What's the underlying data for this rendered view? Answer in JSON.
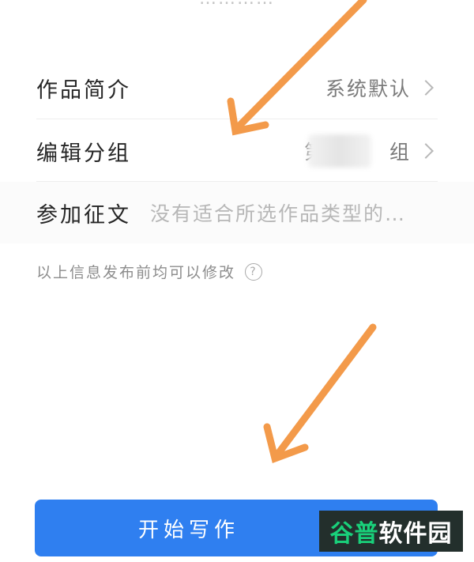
{
  "top_faded_text": "…………",
  "rows": {
    "intro": {
      "label": "作品简介",
      "value": "系统默认"
    },
    "group": {
      "label": "编辑分组",
      "value": "第　　　组"
    },
    "contest": {
      "label": "参加征文",
      "value": "没有适合所选作品类型的…"
    }
  },
  "hint": {
    "text": "以上信息发布前均可以修改",
    "icon": "?"
  },
  "start_button": {
    "label": "开始写作",
    "color": "#2f7ff0"
  },
  "watermark": {
    "brand_a": "谷普",
    "brand_b": "软件园"
  },
  "arrow_color": "#f39a4a"
}
